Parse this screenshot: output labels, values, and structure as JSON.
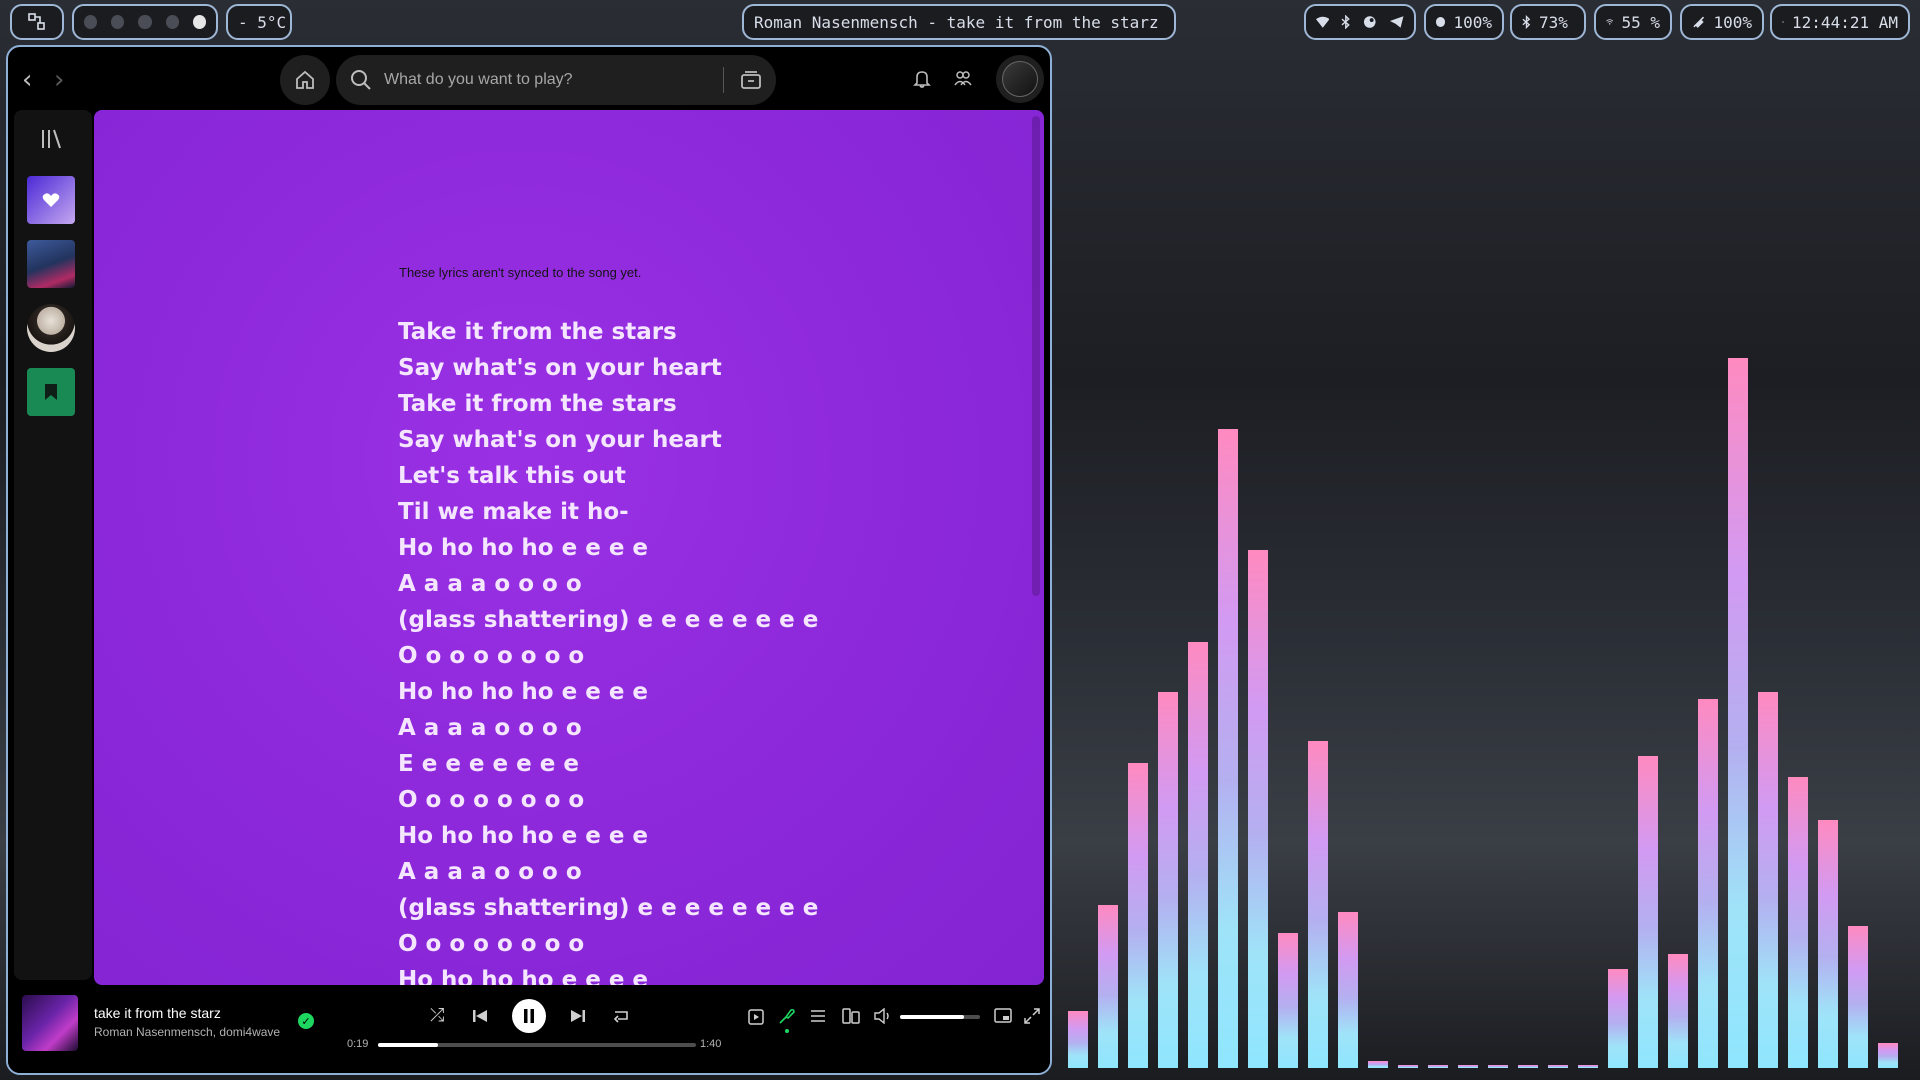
{
  "topbar": {
    "launcher_icon": "grid-icon",
    "workspaces": [
      false,
      false,
      false,
      false,
      true
    ],
    "weather": "- 5°C",
    "now_playing": "Roman Nasenmensch - take it from the starz",
    "tray_icons": [
      "wifi-icon",
      "bluetooth-icon",
      "steam-icon",
      "telegram-icon"
    ],
    "volume": "100%",
    "bluetooth_battery": "73%",
    "wifi": "55 %",
    "battery": "100%",
    "clock": "12:44:21 AM"
  },
  "spotify": {
    "search_placeholder": "What do you want to play?",
    "lyrics_notice": "These lyrics aren't synced to the song yet.",
    "lyrics": [
      "Take it from the stars",
      "Say what's on your heart",
      "Take it from the stars",
      "Say what's on your heart",
      "Let's talk this out",
      "Til we make it ho-",
      "Ho ho ho ho e e e e",
      "A a a a o o o o",
      "(glass shattering) e e e e e e e e",
      "O o o o o o o o",
      "Ho ho ho ho e e e e",
      "A a a a o o o o",
      "E e e e e e e e",
      "O o o o o o o o",
      "Ho ho ho ho e e e e",
      "A a a a o o o o",
      "(glass shattering) e e e e e e e e",
      "O o o o o o o o",
      "Ho ho ho ho e e e e"
    ],
    "player": {
      "title": "take it from the starz",
      "artist": "Roman Nasenmensch, domi4wave",
      "elapsed": "0:19",
      "duration": "1:40",
      "progress_fraction": 0.19,
      "volume_fraction": 0.8
    }
  },
  "visualizer": {
    "levels": [
      0.08,
      0.23,
      0.43,
      0.53,
      0.6,
      0.9,
      0.73,
      0.19,
      0.46,
      0.22,
      0.01,
      0.004,
      0.004,
      0.004,
      0.004,
      0.004,
      0.004,
      0.004,
      0.14,
      0.44,
      0.16,
      0.52,
      1.0,
      0.53,
      0.41,
      0.35,
      0.2,
      0.035
    ],
    "colors": {
      "top": "#ff8ac0",
      "mid": "#c8a4f2",
      "bottom": "#8fe6ff"
    }
  }
}
